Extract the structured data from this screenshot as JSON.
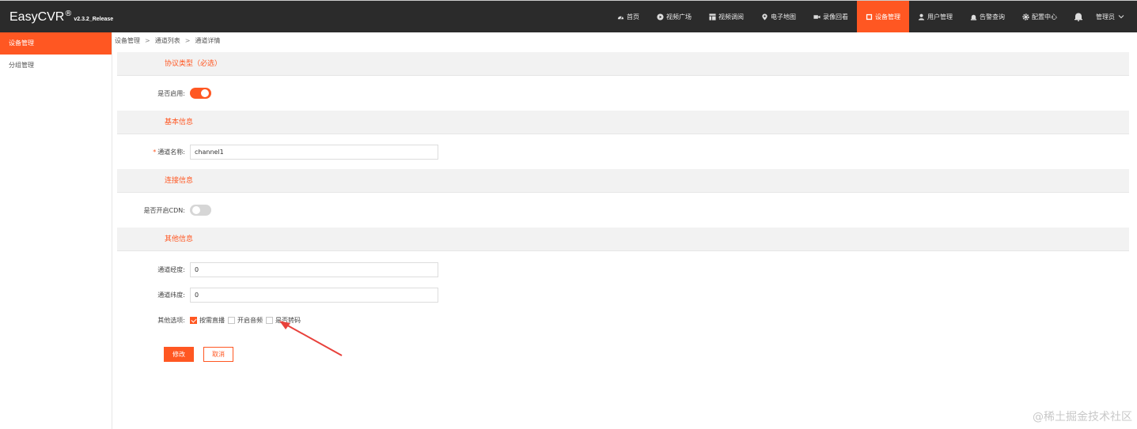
{
  "header": {
    "brand": "EasyCVR",
    "brand_mark": "®",
    "version": "v2.3.2_Release",
    "nav": [
      {
        "label": "首页",
        "icon": "dashboard-icon"
      },
      {
        "label": "视频广场",
        "icon": "play-icon"
      },
      {
        "label": "视频调阅",
        "icon": "grid-icon"
      },
      {
        "label": "电子地图",
        "icon": "map-pin-icon"
      },
      {
        "label": "录像回看",
        "icon": "video-camera-icon"
      },
      {
        "label": "设备管理",
        "icon": "device-icon",
        "active": true
      },
      {
        "label": "用户管理",
        "icon": "user-icon"
      },
      {
        "label": "告警查询",
        "icon": "alarm-icon"
      },
      {
        "label": "配置中心",
        "icon": "gear-icon"
      }
    ],
    "user": "管理员"
  },
  "sidebar": {
    "items": [
      {
        "label": "设备管理",
        "active": true
      },
      {
        "label": "分组管理",
        "active": false
      }
    ]
  },
  "breadcrumb": [
    "设备管理",
    "通道列表",
    "通道详情"
  ],
  "form": {
    "protocol_section": "协议类型（必选）",
    "enabled_label": "是否启用:",
    "enabled": true,
    "basic_section": "基本信息",
    "channel_name_label": "通道名称:",
    "channel_name_value": "channel1",
    "connection_section": "连接信息",
    "cdn_label": "是否开启CDN:",
    "cdn_enabled": false,
    "other_section": "其他信息",
    "longitude_label": "通道经度:",
    "longitude_value": "0",
    "latitude_label": "通道纬度:",
    "latitude_value": "0",
    "options_label": "其他选项:",
    "options": [
      {
        "label": "按需直播",
        "checked": true
      },
      {
        "label": "开启音频",
        "checked": false
      },
      {
        "label": "是否转码",
        "checked": false
      }
    ],
    "submit_label": "修改",
    "cancel_label": "取消"
  },
  "watermark": "@稀土掘金技术社区",
  "colors": {
    "accent": "#ff5722",
    "topbar": "#2b2b2b",
    "annotation": "#e8413b"
  }
}
